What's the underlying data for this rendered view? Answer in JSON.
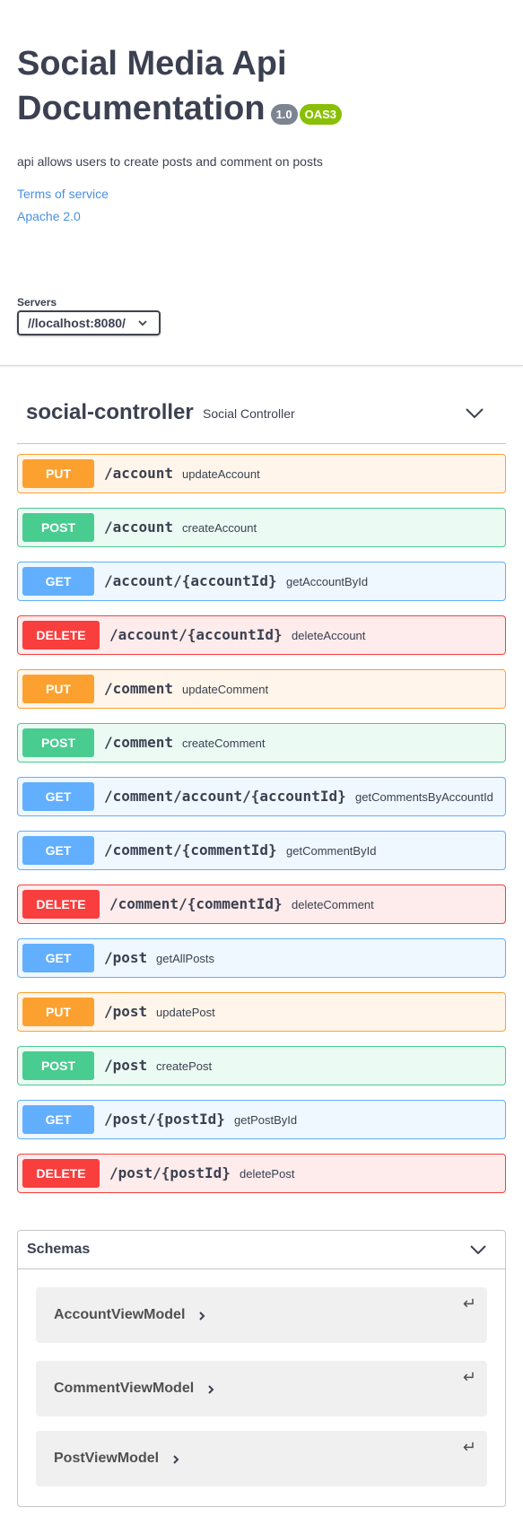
{
  "info": {
    "title_line1": "Social Media Api",
    "title_line2": "Documentation",
    "version": "1.0",
    "oas": "OAS3",
    "description": "api allows users to create posts and comment on posts",
    "terms": "Terms of service",
    "license": "Apache 2.0"
  },
  "servers": {
    "label": "Servers",
    "selected": "//localhost:8080/"
  },
  "tag": {
    "name": "social-controller",
    "description": "Social Controller"
  },
  "operations": [
    {
      "method": "PUT",
      "path": "/account",
      "summary": "updateAccount"
    },
    {
      "method": "POST",
      "path": "/account",
      "summary": "createAccount"
    },
    {
      "method": "GET",
      "path": "/account/{accountId}",
      "summary": "getAccountById"
    },
    {
      "method": "DELETE",
      "path": "/account/{accountId}",
      "summary": "deleteAccount"
    },
    {
      "method": "PUT",
      "path": "/comment",
      "summary": "updateComment"
    },
    {
      "method": "POST",
      "path": "/comment",
      "summary": "createComment"
    },
    {
      "method": "GET",
      "path": "/comment/account/{accountId}",
      "summary": "getCommentsByAccountId"
    },
    {
      "method": "GET",
      "path": "/comment/{commentId}",
      "summary": "getCommentById"
    },
    {
      "method": "DELETE",
      "path": "/comment/{commentId}",
      "summary": "deleteComment"
    },
    {
      "method": "GET",
      "path": "/post",
      "summary": "getAllPosts"
    },
    {
      "method": "PUT",
      "path": "/post",
      "summary": "updatePost"
    },
    {
      "method": "POST",
      "path": "/post",
      "summary": "createPost"
    },
    {
      "method": "GET",
      "path": "/post/{postId}",
      "summary": "getPostById"
    },
    {
      "method": "DELETE",
      "path": "/post/{postId}",
      "summary": "deletePost"
    }
  ],
  "schemas": {
    "title": "Schemas",
    "models": [
      "AccountViewModel",
      "CommentViewModel",
      "PostViewModel"
    ],
    "return_icon": "↵"
  },
  "colors": {
    "put": "#fca130",
    "post": "#49cc90",
    "get": "#61affe",
    "delete": "#f93e3e"
  },
  "icons": {
    "tag_toggle": "chevron-down-icon",
    "schemas_toggle": "chevron-down-icon",
    "model_expand": "chevron-right-icon",
    "server_dropdown": "chevron-down-icon"
  }
}
